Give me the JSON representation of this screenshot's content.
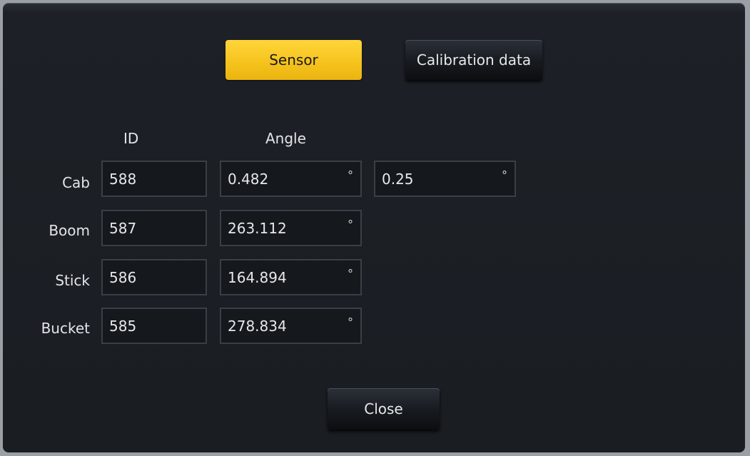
{
  "tabs": {
    "sensor_label": "Sensor",
    "calibration_label": "Calibration data",
    "active_color": "#f5c21c"
  },
  "columns": {
    "id": "ID",
    "angle": "Angle"
  },
  "degree_symbol": "°",
  "rows": [
    {
      "label": "Cab",
      "id": "588",
      "angle": "0.482",
      "extra": "0.25"
    },
    {
      "label": "Boom",
      "id": "587",
      "angle": "263.112"
    },
    {
      "label": "Stick",
      "id": "586",
      "angle": "164.894"
    },
    {
      "label": "Bucket",
      "id": "585",
      "angle": "278.834"
    }
  ],
  "close_label": "Close"
}
